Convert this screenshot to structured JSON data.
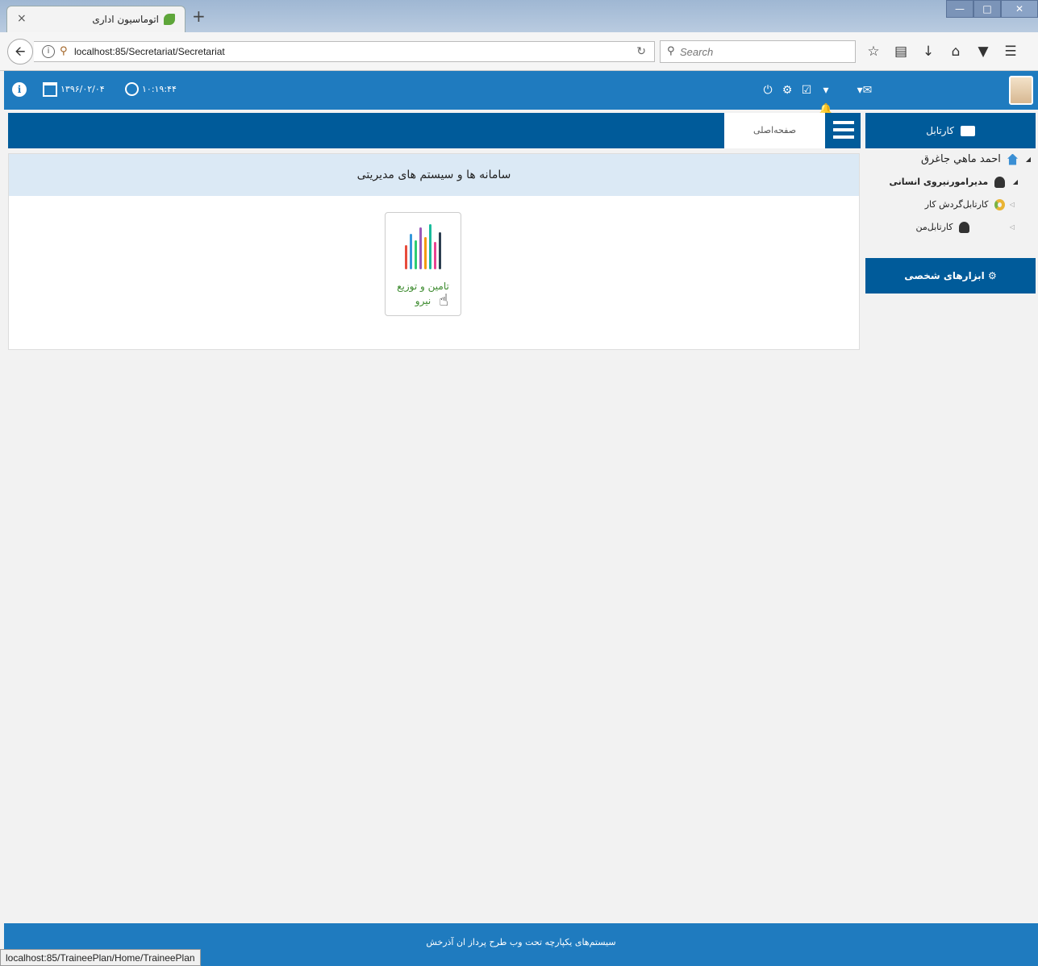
{
  "browser": {
    "tab_title": "اتوماسیون اداری",
    "tab_close": "×",
    "tab_new": "+",
    "url": "localhost:85/Secretariat/Secretariat",
    "search_placeholder": "Search",
    "status_url": "localhost:85/TraineePlan/Home/TraineePlan"
  },
  "header": {
    "date": "۱۳۹۶/۰۲/۰۴",
    "time": "۱۰:۱۹:۴۴"
  },
  "main": {
    "home_tab": "صفحه‌اصلی",
    "panel_title": "سامانه ها و سیستم های مدیریتی",
    "app_card_label": "تامین و توزیع نیرو"
  },
  "sidebar": {
    "title": "کارتابل",
    "items": [
      {
        "label": "احمد ماهي جاغرق"
      },
      {
        "label": "مدیرامورنیروی انسانی"
      },
      {
        "label": "کارتابل‌گردش کار"
      },
      {
        "label": "کارتابل‌من"
      }
    ],
    "tools_label": "ابزارهای شخصی"
  },
  "footer": {
    "text": "سیستم‌های یکپارچه تحت وب طرح پرداز ان آذرخش"
  },
  "colors": {
    "header_blue": "#1f7bbf",
    "bar_blue": "#005b9a",
    "panel_head": "#dbe9f5",
    "card_label_green": "#3d8b2f"
  }
}
